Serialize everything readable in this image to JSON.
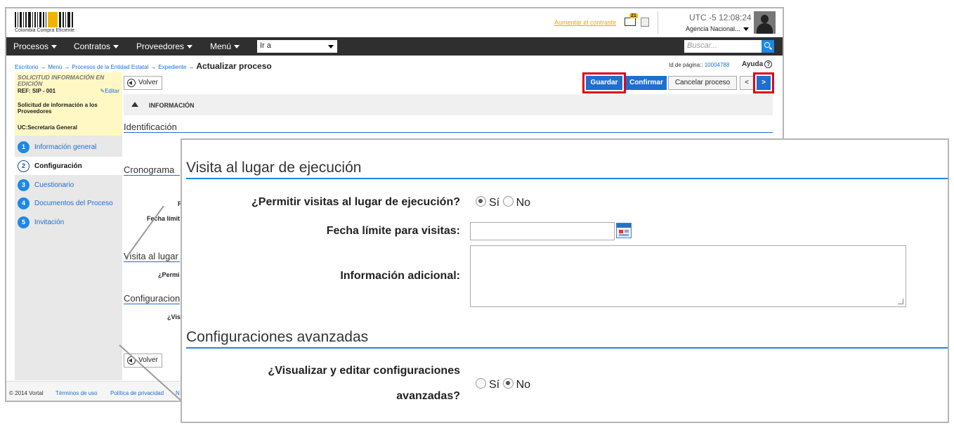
{
  "header": {
    "logo_text": "Colombia Compra Eficiente",
    "contrast_link": "Aumentar el contraste",
    "mail_badge": "21",
    "clock": "UTC -5 12:08:24",
    "agency": "Agencia Nacional..."
  },
  "nav": {
    "items": [
      "Procesos",
      "Contratos",
      "Proveedores",
      "Menú"
    ],
    "goto_value": "Ir a",
    "search_placeholder": "Buscar..."
  },
  "breadcrumb": {
    "items": [
      "Escritorio",
      "Menú",
      "Procesos de la Entidad Estatal",
      "Expediente"
    ],
    "current": "Actualizar proceso"
  },
  "page_info": {
    "id_label": "Id de página::",
    "id_value": "10004788",
    "help": "Ayuda"
  },
  "request": {
    "title": "SOLICITUD INFORMACIÓN EN EDICIÓN",
    "ref": "REF: SIP - 001",
    "edit": "Editar",
    "name": "Solicitud de información a los Proveedores",
    "uc": "UC:Secretaría General"
  },
  "steps": [
    {
      "num": "1",
      "label": "Información general"
    },
    {
      "num": "2",
      "label": "Configuración"
    },
    {
      "num": "3",
      "label": "Cuestionario"
    },
    {
      "num": "4",
      "label": "Documentos del Proceso"
    },
    {
      "num": "5",
      "label": "Invitación"
    }
  ],
  "actions": {
    "back": "Volver",
    "save": "Guardar",
    "confirm": "Confirmar",
    "cancel": "Cancelar proceso",
    "prev": "<",
    "next": ">"
  },
  "main": {
    "info_bar": "INFORMACIÓN",
    "identification": "Identificación",
    "schedule": "Cronograma",
    "schedule_label1": "F",
    "schedule_label2": "Fecha límit",
    "visit_partial": "Visita al lugar",
    "visit_partial_q": "¿Permi",
    "config_partial": "Configuracion",
    "config_partial_q": "¿Vis"
  },
  "footer": {
    "copyright": "© 2014 Vortal",
    "terms": "Términos de uso",
    "privacy": "Política de privacidad",
    "more": "N"
  },
  "zoom": {
    "visit_heading": "Visita al lugar de ejecución",
    "allow_visits_label": "¿Permitir visitas al lugar de ejecución?",
    "yes": "Sí",
    "no": "No",
    "deadline_label": "Fecha límite para visitas:",
    "deadline_value": "",
    "additional_label": "Información adicional:",
    "additional_value": "",
    "advanced_heading": "Configuraciones avanzadas",
    "advanced_label_line1": "¿Visualizar y editar configuraciones",
    "advanced_label_line2": "avanzadas?"
  },
  "colors": {
    "accent": "#1e6fd0",
    "highlight": "#e0001b",
    "navbar": "#2f2f2f",
    "request_box": "#fff8c4"
  }
}
